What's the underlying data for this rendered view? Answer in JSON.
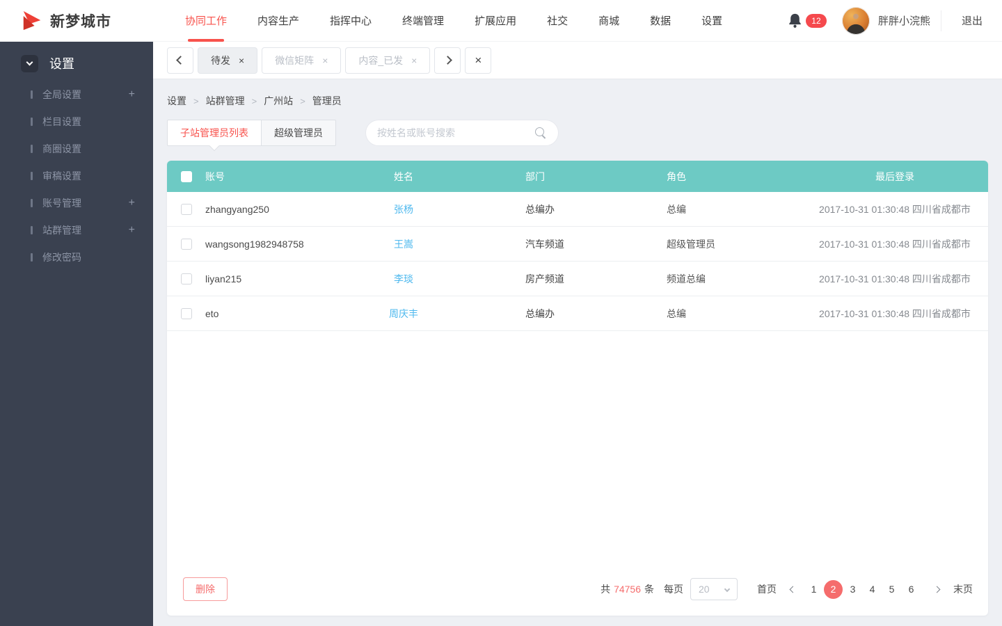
{
  "topbar": {
    "brand": "新梦城市",
    "nav": [
      {
        "label": "协同工作",
        "active": true
      },
      {
        "label": "内容生产",
        "active": false
      },
      {
        "label": "指挥中心",
        "active": false
      },
      {
        "label": "终端管理",
        "active": false
      },
      {
        "label": "扩展应用",
        "active": false
      },
      {
        "label": "社交",
        "active": false
      },
      {
        "label": "商城",
        "active": false
      },
      {
        "label": "数据",
        "active": false
      },
      {
        "label": "设置",
        "active": false
      }
    ],
    "notification_count": "12",
    "username": "胖胖小浣熊",
    "logout_label": "退出"
  },
  "sidebar": {
    "title": "设置",
    "expand_glyph": "+",
    "items": [
      {
        "label": "全局设置",
        "expandable": true
      },
      {
        "label": "栏目设置",
        "expandable": false
      },
      {
        "label": "商圈设置",
        "expandable": false
      },
      {
        "label": "审稿设置",
        "expandable": false
      },
      {
        "label": "账号管理",
        "expandable": true
      },
      {
        "label": "站群管理",
        "expandable": true
      },
      {
        "label": "修改密码",
        "expandable": false
      }
    ]
  },
  "tabstrip": {
    "close_glyph": "×",
    "tabs": [
      {
        "label": "待发",
        "active": true
      },
      {
        "label": "微信矩阵",
        "active": false
      },
      {
        "label": "内容_已发",
        "active": false
      }
    ]
  },
  "breadcrumb": {
    "separator": ">",
    "items": [
      "设置",
      "站群管理",
      "广州站",
      "管理员"
    ]
  },
  "toolbar": {
    "tabs": [
      {
        "label": "子站管理员列表",
        "active": true
      },
      {
        "label": "超级管理员",
        "active": false
      }
    ],
    "search_placeholder": "按姓名或账号搜索"
  },
  "table": {
    "columns": [
      "账号",
      "姓名",
      "部门",
      "角色",
      "最后登录"
    ],
    "rows": [
      {
        "account": "zhangyang250",
        "name": "张杨",
        "dept": "总编办",
        "role": "总编",
        "last_login": "2017-10-31 01:30:48 四川省成都市"
      },
      {
        "account": "wangsong1982948758",
        "name": "王嵩",
        "dept": "汽车频道",
        "role": "超级管理员",
        "last_login": "2017-10-31 01:30:48 四川省成都市"
      },
      {
        "account": "liyan215",
        "name": "李琰",
        "dept": "房产频道",
        "role": "频道总编",
        "last_login": "2017-10-31 01:30:48 四川省成都市"
      },
      {
        "account": "eto",
        "name": "周庆丰",
        "dept": "总编办",
        "role": "总编",
        "last_login": "2017-10-31 01:30:48 四川省成都市"
      }
    ]
  },
  "footer": {
    "delete_label": "删除",
    "total_prefix": "共",
    "total": "74756",
    "total_suffix": "条",
    "per_page_label": "每页",
    "page_size": "20",
    "first_label": "首页",
    "last_label": "末页",
    "pages": [
      "1",
      "2",
      "3",
      "4",
      "5",
      "6"
    ],
    "active_page": "2"
  },
  "colors": {
    "accent_red": "#f8524c",
    "coral": "#f56c6c",
    "badge_red": "#f5494d",
    "teal_header": "#6dcac4",
    "link_blue": "#4db8ee",
    "sidebar_bg": "#3a4150",
    "page_bg": "#eef0f4"
  }
}
